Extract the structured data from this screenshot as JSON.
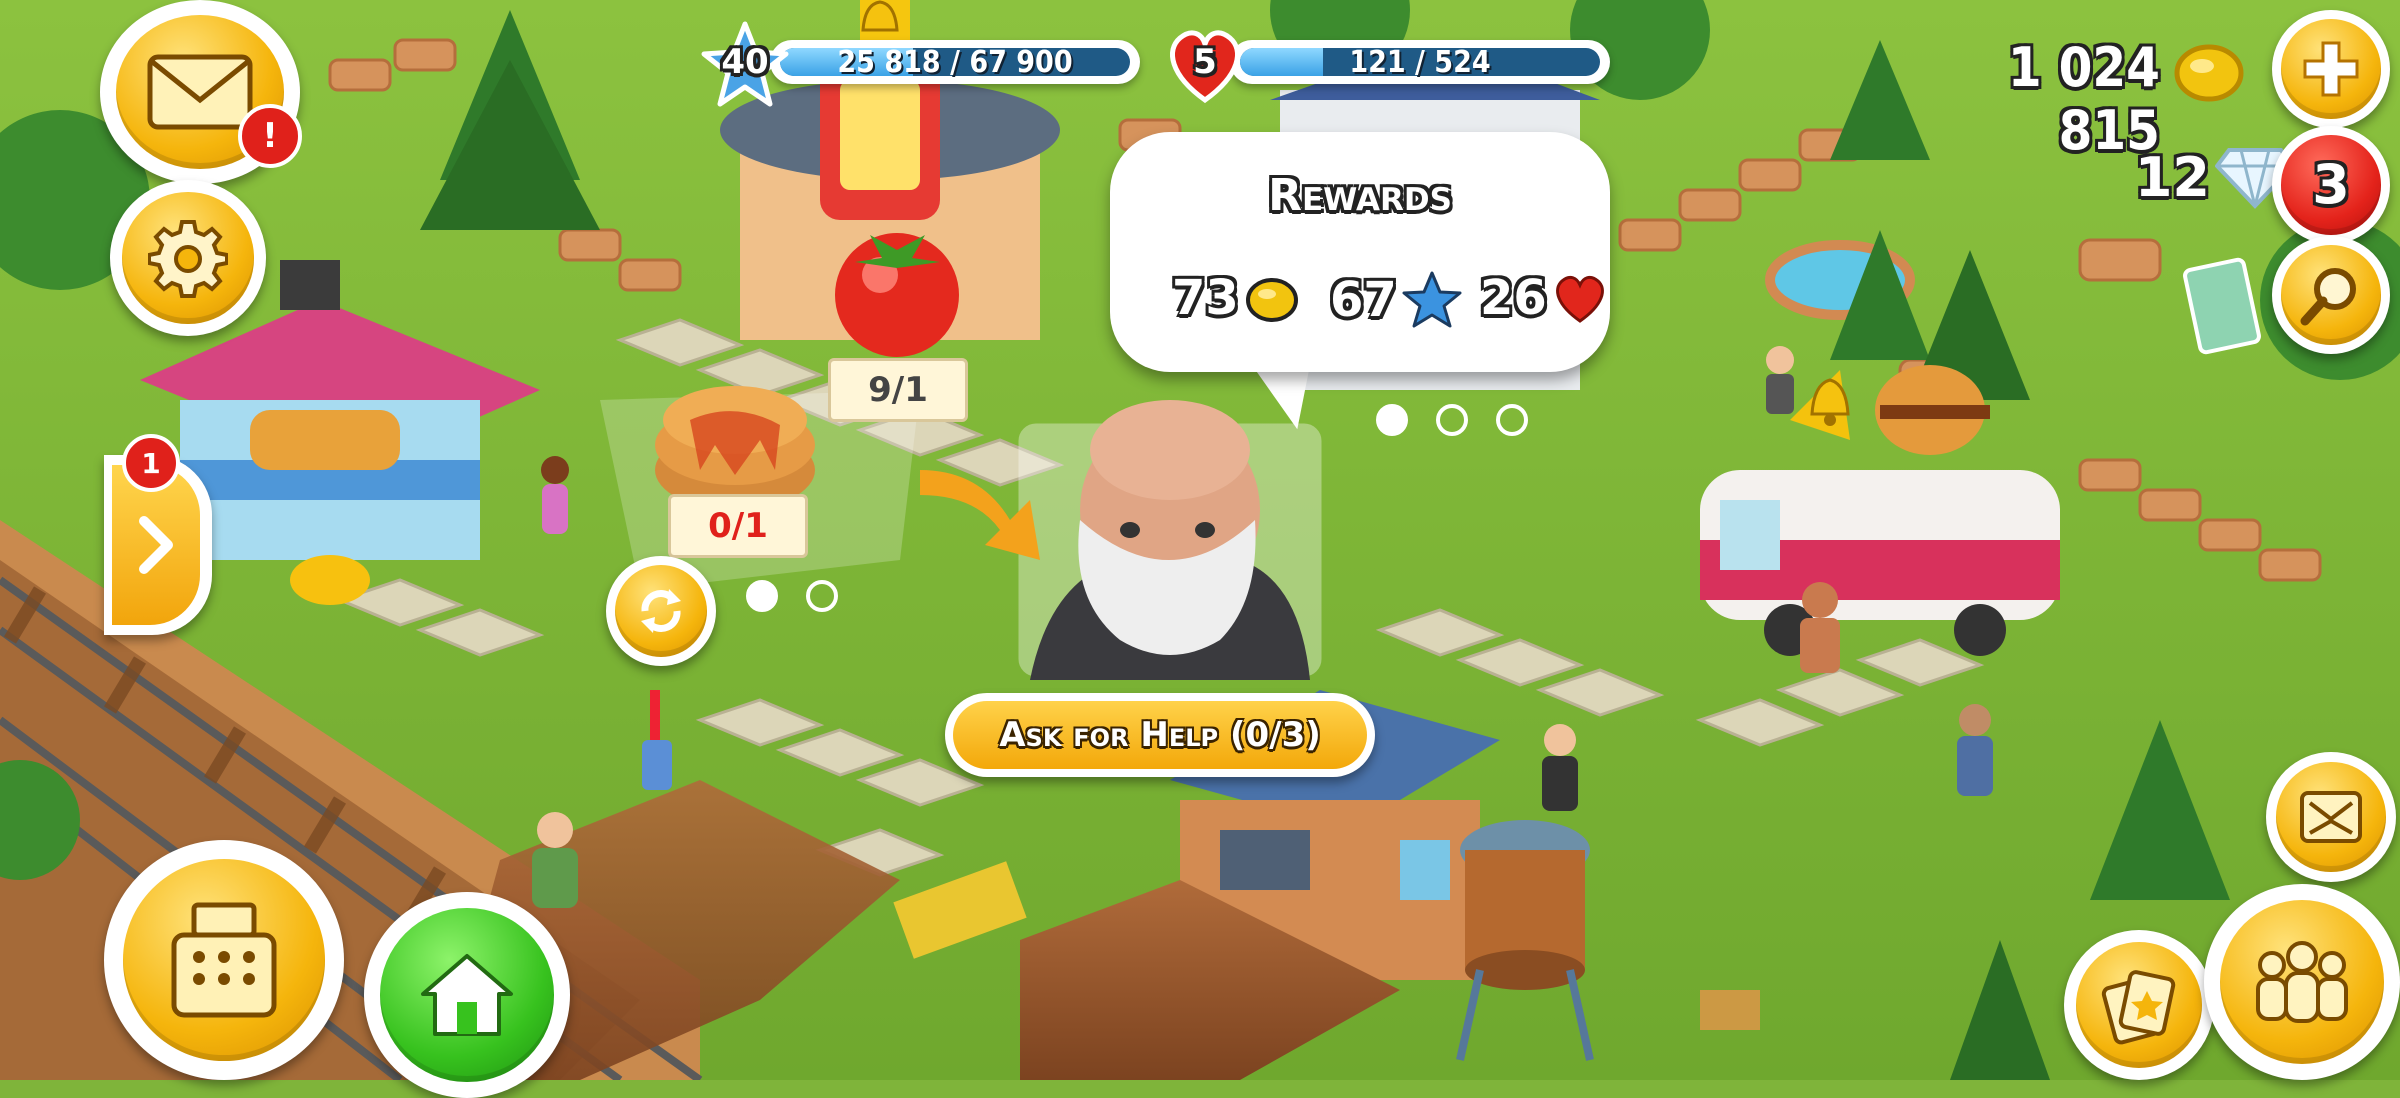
{
  "hud": {
    "level": "40",
    "xp_text": "25 818 / 67 900",
    "xp_fraction": 0.38,
    "hearts_level": "5",
    "hearts_text": "121 / 524",
    "hearts_fraction": 0.23,
    "coins": "1 024 815",
    "diamonds": "12",
    "notifications_count": "3"
  },
  "left_menu": {
    "mail_alert": "!",
    "side_panel_badge": "1"
  },
  "order": {
    "tomato_count": "9/1",
    "pancake_count": "0/1",
    "rewards_title": "Rewards",
    "reward_coins": "73",
    "reward_xp": "67",
    "reward_hearts": "26",
    "ask_help_label": "Ask for Help (0/3)"
  },
  "colors": {
    "gold": "#f5b50c",
    "green": "#37c21e",
    "red": "#e0211b",
    "xp_blue": "#3aa2e6"
  },
  "icons": {
    "mail": "envelope-icon",
    "settings": "gear-icon",
    "side_panel": "chevron-right-icon",
    "cash_register": "cash-register-icon",
    "home": "house-icon",
    "add_coins": "plus-icon",
    "search": "magnifier-icon",
    "friends": "people-icon",
    "expand": "arrows-icon",
    "cards": "cards-icon"
  }
}
